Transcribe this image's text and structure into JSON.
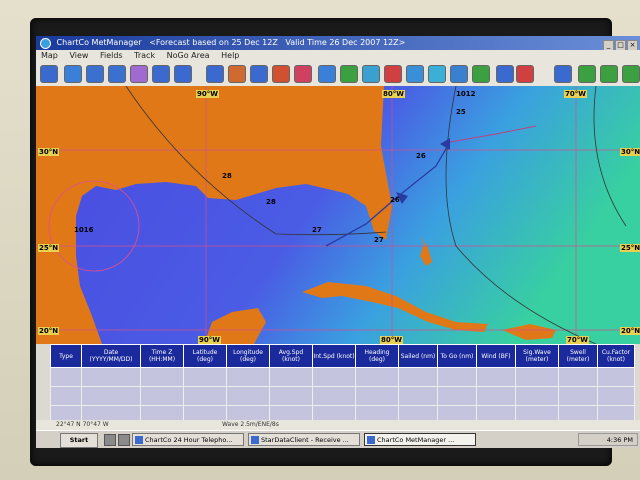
{
  "window": {
    "title": "ChartCo MetManager",
    "subtitle": "<Forecast based on 25 Dec 12Z",
    "valid": "Valid Time 26 Dec 2007 12Z>",
    "controls": [
      "_",
      "□",
      "×"
    ]
  },
  "menu": [
    "Map",
    "View",
    "Fields",
    "Track",
    "NoGo Area",
    "Help"
  ],
  "toolbar": {
    "icons": [
      "layers-icon",
      "refresh-icon",
      "zoom-in-icon",
      "zoom-out-icon",
      "cloud-icon",
      "globe-icon",
      "flag-icon",
      "boat-icon",
      "waves-icon",
      "ship-icon",
      "anchor-icon",
      "pressure-icon",
      "temperature-icon",
      "wind-icon",
      "rain-icon",
      "current-icon",
      "swell-icon",
      "route-icon",
      "settings-icon",
      "arrow-icon",
      "target-icon",
      "play-icon",
      "calendar-icon",
      "print-icon",
      "back-icon",
      "forward-icon",
      "sound-icon"
    ]
  },
  "map": {
    "lon_labels": [
      "90°W",
      "80°W",
      "70°W",
      "90°W",
      "80°W",
      "70°W"
    ],
    "lat_labels": [
      "30°N",
      "25°N",
      "20°N",
      "30°N",
      "25°N",
      "20°N"
    ],
    "isobar_labels": [
      "1012",
      "1016",
      "25",
      "26",
      "26",
      "27",
      "27",
      "28",
      "28"
    ]
  },
  "table": {
    "headers": [
      "Type",
      "Date (YYYY/MM/DD)",
      "Time Z (HH:MM)",
      "Latitude (deg)",
      "Longitude (deg)",
      "Avg.Spd (knot)",
      "Int.Spd (knot)",
      "Heading (deg)",
      "Sailed (nm)",
      "To Go (nm)",
      "Wind (BF)",
      "Sig.Wave (meter)",
      "Swell (meter)",
      "Cu.Factor (knot)"
    ],
    "rows": [
      [
        "",
        "",
        "",
        "",
        "",
        "",
        "",
        "",
        "",
        "",
        "",
        "",
        "",
        ""
      ],
      [
        "",
        "",
        "",
        "",
        "",
        "",
        "",
        "",
        "",
        "",
        "",
        "",
        "",
        ""
      ],
      [
        "",
        "",
        "",
        "",
        "",
        "",
        "",
        "",
        "",
        "",
        "",
        "",
        "",
        ""
      ]
    ]
  },
  "status": {
    "coords": "22°47 N   70°47 W",
    "info": "Wave 2.5m/ENE/8s"
  },
  "taskbar": {
    "start": "Start",
    "tasks": [
      "ChartCo 24 Hour Telepho...",
      "StarDataClient - Receive ...",
      "ChartCo MetManager ..."
    ],
    "clock": "4:36 PM"
  },
  "colors": {
    "land": "#e07818",
    "ocean_deep": "#4a4ae0",
    "ocean_mid": "#3aa0e0",
    "ocean_shallow": "#3ad0a8",
    "title_bar": "#1a3a9c",
    "grid_header": "#1a2a9c"
  }
}
